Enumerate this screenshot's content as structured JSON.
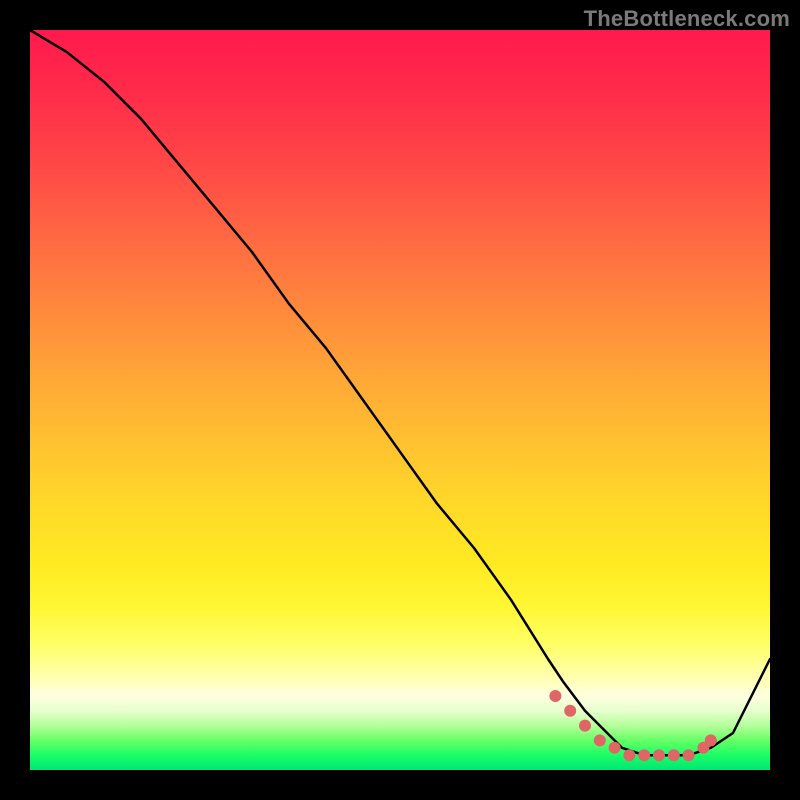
{
  "watermark": "TheBottleneck.com",
  "colors": {
    "curve": "#000000",
    "marker": "#e06666",
    "gradient_top": "#ff1a4d",
    "gradient_bottom": "#00e676"
  },
  "chart_data": {
    "type": "line",
    "title": "",
    "xlabel": "",
    "ylabel": "",
    "xlim": [
      0,
      100
    ],
    "ylim": [
      0,
      100
    ],
    "grid": false,
    "legend": false,
    "series": [
      {
        "name": "curve",
        "x": [
          0,
          5,
          10,
          15,
          20,
          25,
          30,
          35,
          40,
          45,
          50,
          55,
          60,
          65,
          70,
          72,
          75,
          78,
          80,
          83,
          86,
          89,
          92,
          95,
          100
        ],
        "values": [
          100,
          97,
          93,
          88,
          82,
          76,
          70,
          63,
          57,
          50,
          43,
          36,
          30,
          23,
          15,
          12,
          8,
          5,
          3,
          2,
          2,
          2,
          3,
          5,
          15
        ]
      }
    ],
    "markers": {
      "name": "highlight-dots",
      "color": "#e06666",
      "x": [
        71,
        73,
        75,
        77,
        79,
        81,
        83,
        85,
        87,
        89,
        91,
        92
      ],
      "values": [
        10,
        8,
        6,
        4,
        3,
        2,
        2,
        2,
        2,
        2,
        3,
        4
      ]
    }
  }
}
